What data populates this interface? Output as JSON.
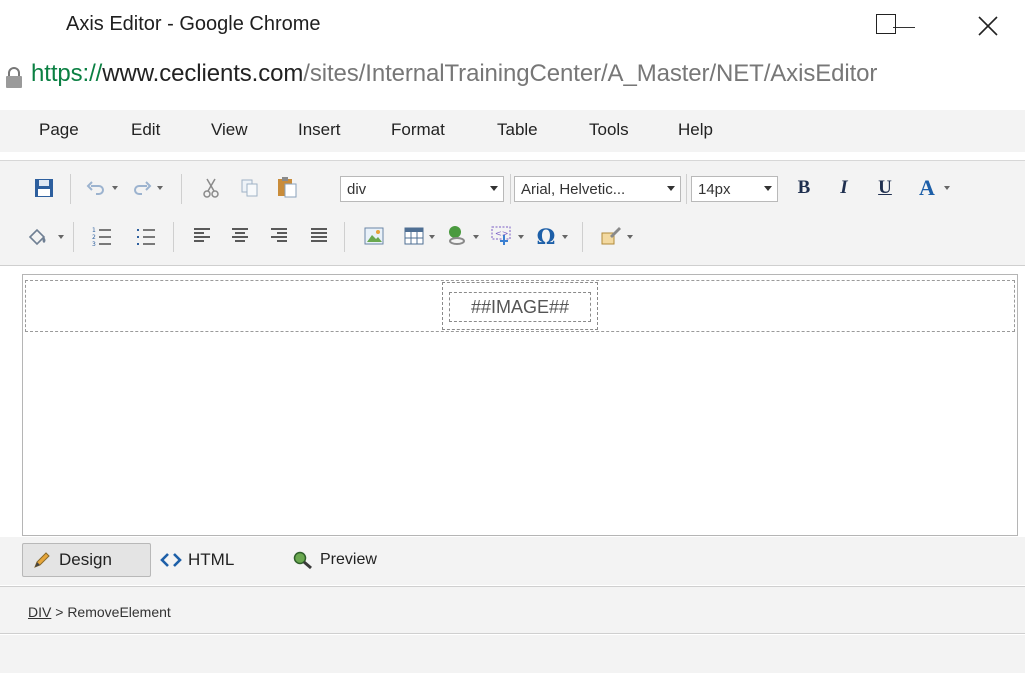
{
  "window": {
    "title": "Axis Editor - Google Chrome",
    "controls": {
      "minimize": "minimize",
      "maximize": "maximize",
      "close": "close"
    }
  },
  "address": {
    "scheme": "https://",
    "host": "www.ceclients.com",
    "path": "/sites/InternalTrainingCenter/A_Master/NET/AxisEditor"
  },
  "menu": [
    "Page",
    "Edit",
    "View",
    "Insert",
    "Format",
    "Table",
    "Tools",
    "Help"
  ],
  "toolbar": {
    "block_format": "div",
    "font_family": "Arial, Helvetic...",
    "font_size": "14px",
    "bold": "B",
    "italic": "I",
    "underline": "U",
    "font_color": "A",
    "special_char": "Ω"
  },
  "editor": {
    "placeholder": "##IMAGE##"
  },
  "modes": {
    "design": "Design",
    "html": "HTML",
    "preview": "Preview"
  },
  "breadcrumb": {
    "tag": "DIV",
    "separator": ">",
    "element": "RemoveElement"
  },
  "colors": {
    "secure_green": "#0b8043",
    "toolbar_bg": "#f3f3f3",
    "icon_blue": "#1d5fa8"
  }
}
